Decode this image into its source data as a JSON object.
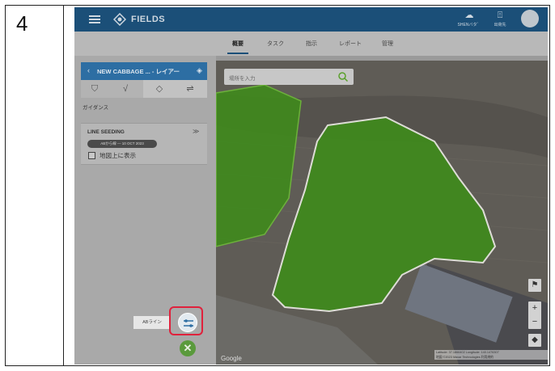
{
  "step": {
    "number": "4"
  },
  "topbar": {
    "brand": "FIELDS",
    "btn_sync_label": "SHENバタ゛",
    "btn_export_label": "出荷先"
  },
  "nav": {
    "tabs": [
      {
        "label": "概要",
        "active": true
      },
      {
        "label": "タスク",
        "active": false
      },
      {
        "label": "指示",
        "active": false
      },
      {
        "label": "レポート",
        "active": false
      },
      {
        "label": "管理",
        "active": false
      }
    ]
  },
  "panel": {
    "header_title": "NEW CABBAGE ... - レイアー",
    "section_label": "ガイダンス",
    "line_card": {
      "title": "LINE SEEDING",
      "pill": "ABから線 — 10 OCT 2023",
      "checkbox_label": "地図上に表示",
      "checked": false
    },
    "ab_tooltip": "ABライン"
  },
  "map": {
    "search_placeholder": "場所を入力",
    "coords_line1": "Latitude: 37.1866402 Longitude: 140.1476307",
    "coords_line2": "地図 ©2023 Maxar Technologies  利用規約",
    "google_label": "Google"
  },
  "colors": {
    "topbar": "#1b4f78",
    "panel_header": "#2d6ea3",
    "field_fill": "#3f8a1c",
    "highlight": "#e0213c",
    "close_button": "#5a9a3c"
  }
}
